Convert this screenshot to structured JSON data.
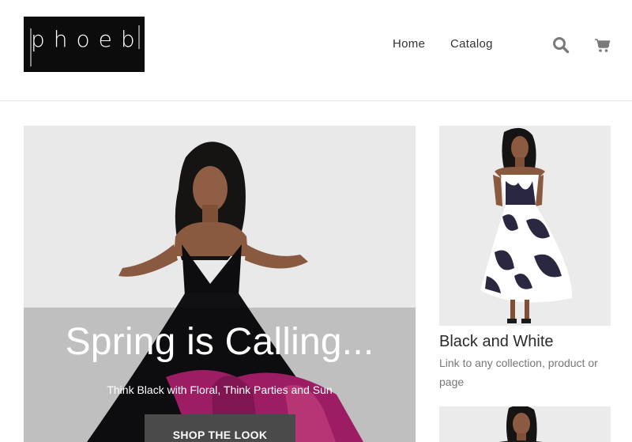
{
  "brand": {
    "logo_text": "phoebe"
  },
  "nav": {
    "home": "Home",
    "catalog": "Catalog"
  },
  "icons": {
    "search": "search-icon",
    "cart": "cart-icon"
  },
  "hero": {
    "title": "Spring is Calling...",
    "subtitle": "Think Black with Floral, Think Parties and Sun",
    "cta": "SHOP THE LOOK"
  },
  "featured": [
    {
      "title": "Black and White",
      "description": "Link to any collection, product or page"
    }
  ],
  "colors": {
    "accent": "#4a4a4a",
    "background": "#ffffff",
    "dress_pink": "#c0247a"
  }
}
